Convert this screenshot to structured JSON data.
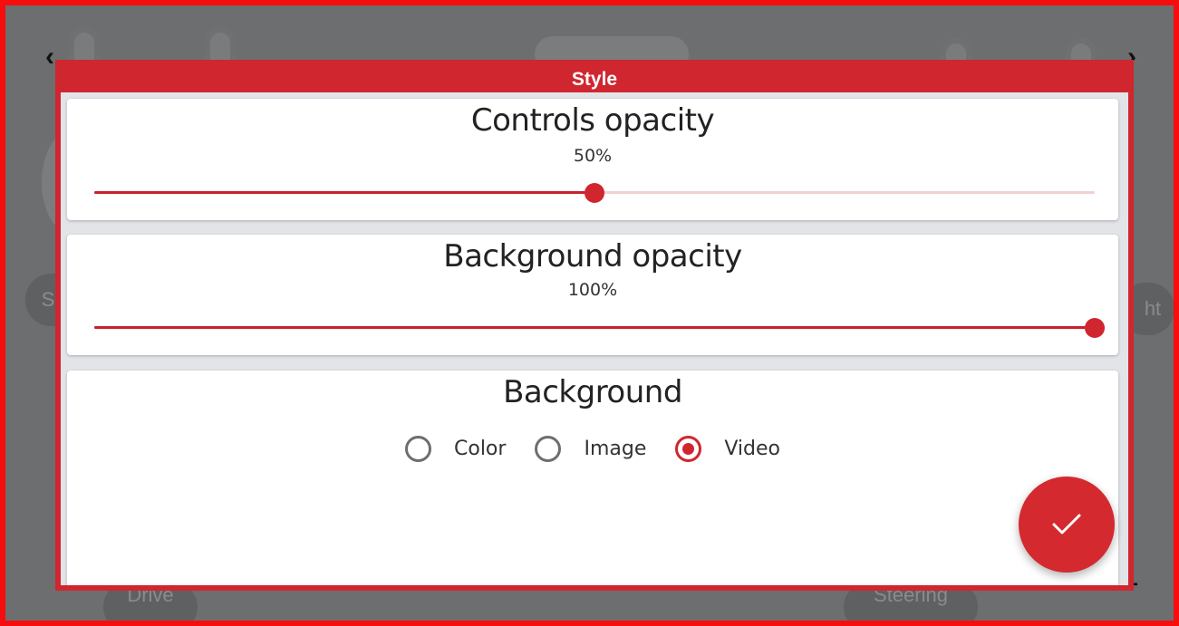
{
  "dialog": {
    "title": "Style"
  },
  "controls_opacity": {
    "title": "Controls opacity",
    "value_text": "50%",
    "value": 0.5
  },
  "background_opacity": {
    "title": "Background opacity",
    "value_text": "100%",
    "value": 1.0
  },
  "background": {
    "title": "Background",
    "options": [
      {
        "label": "Color",
        "checked": false
      },
      {
        "label": "Image",
        "checked": false
      },
      {
        "label": "Video",
        "checked": true
      }
    ]
  },
  "confirm": {
    "icon": "check-icon"
  },
  "backdrop": {
    "left_pill_fragment": "S",
    "right_pill_fragment": "ht",
    "bottom_left_pill": "Drive",
    "bottom_right_pill": "Steering"
  },
  "colors": {
    "accent": "#d0262f",
    "frame": "#f70d0d",
    "backdrop": "#6d6e70"
  }
}
